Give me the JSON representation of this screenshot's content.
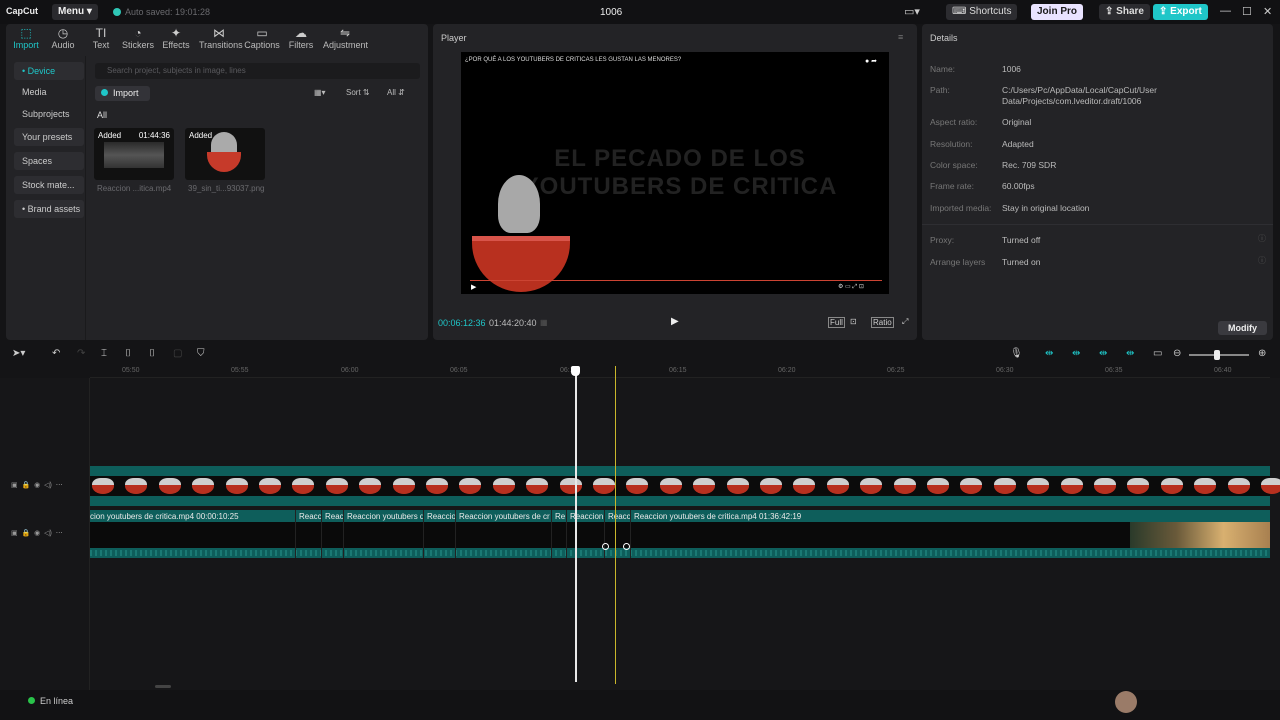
{
  "titlebar": {
    "logo": "CapCut",
    "menu": "Menu",
    "autosave": "Auto saved: 19:01:28",
    "project": "1006",
    "shortcuts": "Shortcuts",
    "join_pro": "Join Pro",
    "share": "Share",
    "export": "Export"
  },
  "tools": [
    {
      "label": "Import",
      "icon": "import-icon"
    },
    {
      "label": "Audio",
      "icon": "audio-icon"
    },
    {
      "label": "Text",
      "icon": "text-icon"
    },
    {
      "label": "Stickers",
      "icon": "stickers-icon"
    },
    {
      "label": "Effects",
      "icon": "effects-icon"
    },
    {
      "label": "Transitions",
      "icon": "transitions-icon"
    },
    {
      "label": "Captions",
      "icon": "captions-icon"
    },
    {
      "label": "Filters",
      "icon": "filters-icon"
    },
    {
      "label": "Adjustment",
      "icon": "adjustment-icon"
    }
  ],
  "sidenav": [
    "• Device",
    "Media",
    "Subprojects",
    "Your presets",
    "Spaces",
    "Stock mate...",
    "• Brand assets"
  ],
  "media": {
    "search_placeholder": "Search project, subjects in image, lines",
    "import": "Import",
    "sort": "Sort",
    "all_filter": "All",
    "all_label": "All",
    "items": [
      {
        "tag": "Added",
        "duration": "01:44:36",
        "name": "Reaccion ...itica.mp4"
      },
      {
        "tag": "Added",
        "duration": "",
        "name": "39_sin_ti...93037.png"
      }
    ]
  },
  "player": {
    "title": "Player",
    "video_top_text": "¿POR QUÉ A LOS YOUTUBERS DE CRITICAS LES GUSTAN LAS MENORES?",
    "video_big_text": "EL PECADO DE LOS YOUTUBERS DE CRITICA",
    "current_time": "00:06:12:36",
    "total_time": "01:44:20:40",
    "full": "Full",
    "ratio": "Ratio"
  },
  "details": {
    "title": "Details",
    "rows": [
      {
        "key": "Name:",
        "value": "1006"
      },
      {
        "key": "Path:",
        "value": "C:/Users/Pc/AppData/Local/CapCut/User Data/Projects/com.lveditor.draft/1006"
      },
      {
        "key": "Aspect ratio:",
        "value": "Original"
      },
      {
        "key": "Resolution:",
        "value": "Adapted"
      },
      {
        "key": "Color space:",
        "value": "Rec. 709 SDR"
      },
      {
        "key": "Frame rate:",
        "value": "60.00fps"
      },
      {
        "key": "Imported media:",
        "value": "Stay in original location"
      },
      {
        "key": "Proxy:",
        "value": "Turned off"
      },
      {
        "key": "Arrange layers",
        "value": "Turned on"
      }
    ],
    "modify": "Modify"
  },
  "timeline": {
    "ruler": [
      "05:50",
      "05:55",
      "06:00",
      "06:05",
      "06:10",
      "06:15",
      "06:20",
      "06:25",
      "06:30",
      "06:35",
      "06:40"
    ],
    "clips": [
      {
        "label": "cion youtubers de critica.mp4  00:00:10:25"
      },
      {
        "label": "Reacc"
      },
      {
        "label": "Reac"
      },
      {
        "label": "Reaccion youtubers de c"
      },
      {
        "label": "Reaccio"
      },
      {
        "label": "Reaccion youtubers de cr"
      },
      {
        "label": "Re"
      },
      {
        "label": "Reaccion"
      },
      {
        "label": "Reacc"
      },
      {
        "label": "Reaccion youtubers de critica.mp4  01:36:42:19"
      }
    ]
  },
  "status": {
    "online": "En línea"
  }
}
